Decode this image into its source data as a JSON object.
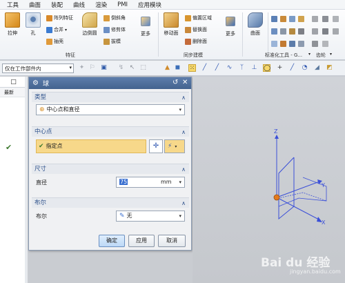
{
  "menu": [
    "工具",
    "曲面",
    "装配",
    "曲线",
    "渲染",
    "PMI",
    "应用模块"
  ],
  "ribbon": {
    "features": {
      "extrude": "拉伸",
      "hole": "孔",
      "pattern": "阵列特征",
      "unite": "合并",
      "shell": "抽壳",
      "edge_blend": "边倒圆",
      "chamfer": "倒斜角",
      "trim_body": "修剪体",
      "draft": "拔模",
      "more": "更多",
      "group": "特征"
    },
    "sync": {
      "move_face": "移动面",
      "offset_region": "偏置区域",
      "replace_face": "替换面",
      "delete_face": "删除面",
      "more": "更多",
      "group": "同步建模"
    },
    "surface": {
      "label": "曲面"
    },
    "standard_tools_group": "标准化工具 - G...",
    "gear_group": "齿轮"
  },
  "selection": {
    "filter": "仅在工作部件内"
  },
  "left_strip": {
    "header": "□",
    "col_label": "最新",
    "check": "✔"
  },
  "dialog": {
    "title": "球",
    "type_section": "类型",
    "type_value": "中心点和直径",
    "center_section": "中心点",
    "specify_point": "指定点",
    "size_section": "尺寸",
    "diameter_label": "直径",
    "diameter_value": "75",
    "diameter_unit": "mm",
    "boolean_section": "布尔",
    "boolean_label": "布尔",
    "boolean_value": "无",
    "ok": "确定",
    "apply": "应用",
    "cancel": "取消"
  },
  "viewport": {
    "axis_x": "X",
    "axis_y": "Y",
    "axis_z": "Z",
    "axis_color": "#3a4fd8",
    "origin_color": "#e37a1c"
  },
  "watermark": {
    "logo": "Bai du 经验",
    "url": "jingyan.baidu.com"
  }
}
